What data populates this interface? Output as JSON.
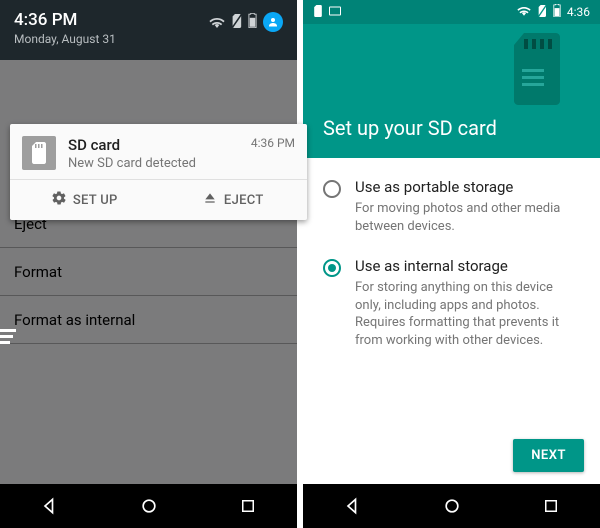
{
  "left": {
    "statusbar": {
      "time": "4:36 PM",
      "date": "Monday, August 31"
    },
    "notification": {
      "title": "SD card",
      "subtitle": "New SD card detected",
      "time": "4:36 PM",
      "actions": {
        "setup": "SET UP",
        "eject": "EJECT"
      }
    },
    "menu": {
      "items": [
        "Eject",
        "Format",
        "Format as internal"
      ]
    }
  },
  "right": {
    "statusbar": {
      "time": "4:36"
    },
    "hero": {
      "title": "Set up your SD card"
    },
    "options": [
      {
        "id": "portable",
        "label": "Use as portable storage",
        "desc": "For moving photos and other media between devices.",
        "selected": false
      },
      {
        "id": "internal",
        "label": "Use as internal storage",
        "desc": "For storing anything on this device only, including apps and photos. Requires formatting that prevents it from working with other devices.",
        "selected": true
      }
    ],
    "next": "NEXT"
  }
}
